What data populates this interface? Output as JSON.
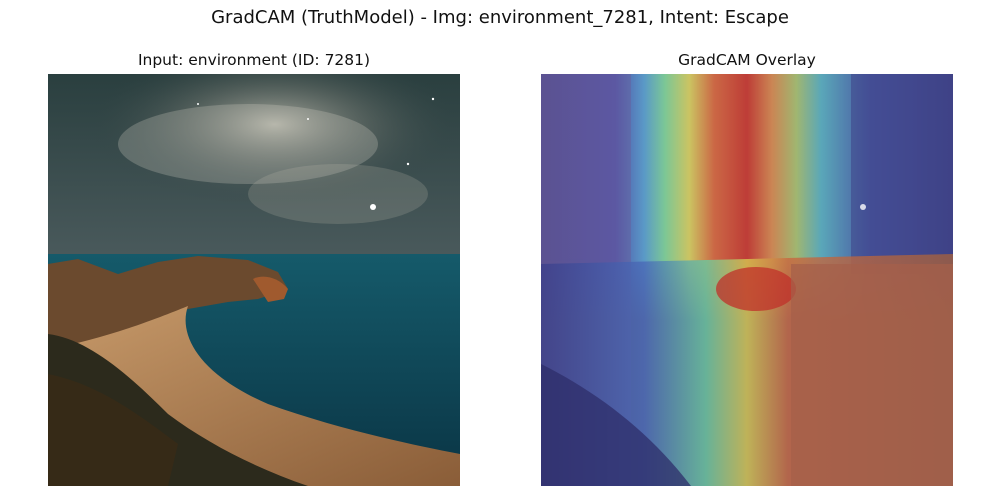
{
  "figure": {
    "title": "GradCAM (TruthModel) - Img: environment_7281, Intent: Escape"
  },
  "panels": [
    {
      "title": "Input: environment (ID: 7281)",
      "content": "coastal-night-sky-photo"
    },
    {
      "title": "GradCAM Overlay",
      "content": "gradcam-heatmap-overlay",
      "colormap": "jet"
    }
  ],
  "colors": {
    "sky_dark": "#1d3436",
    "sea": "#0c5a6a",
    "cliff": "#6b4a2e",
    "sand": "#b98a5a",
    "heat_low": "#3b3f9a",
    "heat_mid": "#3fd08a",
    "heat_high": "#c0302a"
  }
}
